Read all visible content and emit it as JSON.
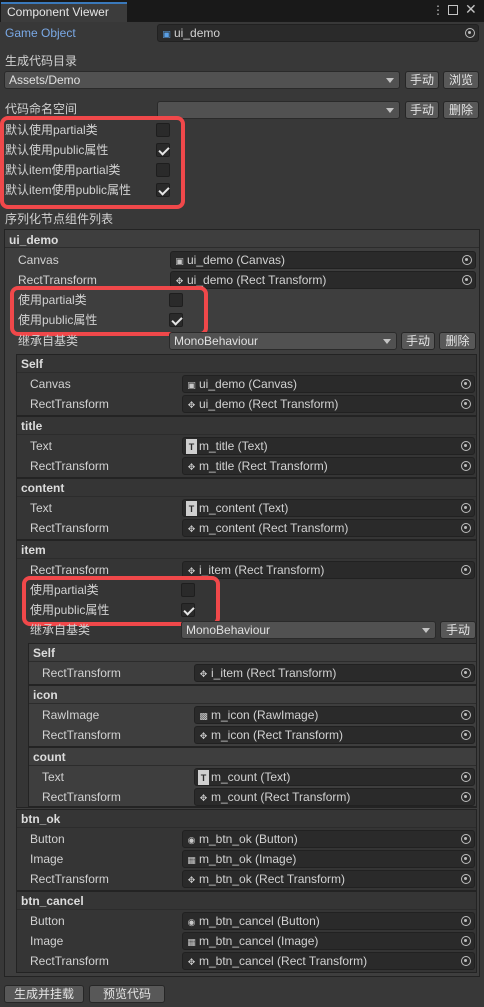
{
  "window": {
    "tab_title": "Component Viewer"
  },
  "header": {
    "game_object_label": "Game Object",
    "game_object_value": "ui_demo"
  },
  "gen_dir": {
    "label": "生成代码目录",
    "value": "Assets/Demo",
    "manual_button": "手动",
    "browse_button": "浏览"
  },
  "namespace": {
    "label": "代码命名空间",
    "value": "",
    "manual_button": "手动",
    "delete_button": "删除"
  },
  "defaults": [
    {
      "label": "默认使用partial类",
      "checked": false
    },
    {
      "label": "默认使用public属性",
      "checked": true
    },
    {
      "label": "默认item使用partial类",
      "checked": false
    },
    {
      "label": "默认item使用public属性",
      "checked": true
    }
  ],
  "list_title": "序列化节点组件列表",
  "root": {
    "name": "ui_demo",
    "rows": [
      {
        "label": "Canvas",
        "icon": "canvas-icon",
        "value": "ui_demo (Canvas)"
      },
      {
        "label": "RectTransform",
        "icon": "rect-transform-icon",
        "value": "ui_demo (Rect Transform)"
      }
    ],
    "use_partial": {
      "label": "使用partial类",
      "checked": false
    },
    "use_public": {
      "label": "使用public属性",
      "checked": true
    },
    "base_class": {
      "label": "继承自基类",
      "value": "MonoBehaviour",
      "manual_button": "手动",
      "delete_button": "删除"
    }
  },
  "self_group": {
    "name": "Self",
    "rows": [
      {
        "label": "Canvas",
        "icon": "canvas-icon",
        "value": "ui_demo (Canvas)"
      },
      {
        "label": "RectTransform",
        "icon": "rect-transform-icon",
        "value": "ui_demo (Rect Transform)"
      }
    ]
  },
  "title_group": {
    "name": "title",
    "rows": [
      {
        "label": "Text",
        "icon": "text-icon",
        "value": "m_title (Text)"
      },
      {
        "label": "RectTransform",
        "icon": "rect-transform-icon",
        "value": "m_title (Rect Transform)"
      }
    ]
  },
  "content_group": {
    "name": "content",
    "rows": [
      {
        "label": "Text",
        "icon": "text-icon",
        "value": "m_content (Text)"
      },
      {
        "label": "RectTransform",
        "icon": "rect-transform-icon",
        "value": "m_content (Rect Transform)"
      }
    ]
  },
  "item_group": {
    "name": "item",
    "rows": [
      {
        "label": "RectTransform",
        "icon": "rect-transform-icon",
        "value": "i_item (Rect Transform)"
      }
    ],
    "use_partial": {
      "label": "使用partial类",
      "checked": false
    },
    "use_public": {
      "label": "使用public属性",
      "checked": true
    },
    "base_class": {
      "label": "继承自基类",
      "value": "MonoBehaviour",
      "manual_button": "手动"
    },
    "self": {
      "name": "Self",
      "rows": [
        {
          "label": "RectTransform",
          "icon": "rect-transform-icon",
          "value": "i_item (Rect Transform)"
        }
      ]
    },
    "icon": {
      "name": "icon",
      "rows": [
        {
          "label": "RawImage",
          "icon": "raw-image-icon",
          "value": "m_icon (RawImage)"
        },
        {
          "label": "RectTransform",
          "icon": "rect-transform-icon",
          "value": "m_icon (Rect Transform)"
        }
      ]
    },
    "count": {
      "name": "count",
      "rows": [
        {
          "label": "Text",
          "icon": "text-icon",
          "value": "m_count (Text)"
        },
        {
          "label": "RectTransform",
          "icon": "rect-transform-icon",
          "value": "m_count (Rect Transform)"
        }
      ]
    }
  },
  "btn_ok_group": {
    "name": "btn_ok",
    "rows": [
      {
        "label": "Button",
        "icon": "button-icon",
        "value": "m_btn_ok (Button)"
      },
      {
        "label": "Image",
        "icon": "image-icon",
        "value": "m_btn_ok (Image)"
      },
      {
        "label": "RectTransform",
        "icon": "rect-transform-icon",
        "value": "m_btn_ok (Rect Transform)"
      }
    ]
  },
  "btn_cancel_group": {
    "name": "btn_cancel",
    "rows": [
      {
        "label": "Button",
        "icon": "button-icon",
        "value": "m_btn_cancel (Button)"
      },
      {
        "label": "Image",
        "icon": "image-icon",
        "value": "m_btn_cancel (Image)"
      },
      {
        "label": "RectTransform",
        "icon": "rect-transform-icon",
        "value": "m_btn_cancel (Rect Transform)"
      }
    ]
  },
  "footer": {
    "generate_button": "生成并挂载",
    "preview_button": "预览代码"
  },
  "colors": {
    "accent": "#3a79bb",
    "highlight": "#f0484a",
    "label_blue": "#7aa9e6"
  }
}
